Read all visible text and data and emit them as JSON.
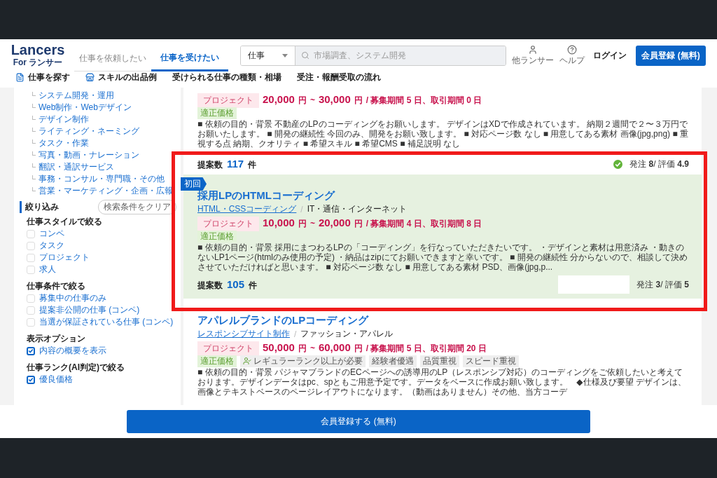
{
  "header": {
    "logo": "Lancers",
    "logo_sub": "For ランサー",
    "mode_tabs": [
      {
        "label": "仕事を依頼したい",
        "selected": false
      },
      {
        "label": "仕事を受けたい",
        "selected": true
      }
    ],
    "search": {
      "category": "仕事",
      "placeholder": "市場調査、システム開発"
    },
    "icon_links": [
      {
        "kind": "user",
        "label": "他ランサー"
      },
      {
        "kind": "help",
        "label": "ヘルプ"
      }
    ],
    "login": "ログイン",
    "register": "会員登録 (無料)"
  },
  "subnav": [
    {
      "kind": "doc",
      "label": "仕事を探す"
    },
    {
      "kind": "shop",
      "label": "スキルの出品例"
    },
    {
      "kind": "text",
      "label": "受けられる仕事の種類・相場"
    },
    {
      "kind": "text",
      "label": "受注・報酬受取の流れ"
    }
  ],
  "sidebar": {
    "categories": [
      "システム開発・運用",
      "Web制作・Webデザイン",
      "デザイン制作",
      "ライティング・ネーミング",
      "タスク・作業",
      "写真・動画・ナレーション",
      "翻訳・通訳サービス",
      "事務・コンサル・専門職・その他",
      "営業・マーケティング・企画・広報"
    ],
    "filter_title": "絞り込み",
    "clear": "検索条件をクリア",
    "groups": [
      {
        "title": "仕事スタイルで絞る",
        "options": [
          {
            "label": "コンペ",
            "checked": false
          },
          {
            "label": "タスク",
            "checked": false
          },
          {
            "label": "プロジェクト",
            "checked": false
          },
          {
            "label": "求人",
            "checked": false
          }
        ]
      },
      {
        "title": "仕事条件で絞る",
        "options": [
          {
            "label": "募集中の仕事のみ",
            "checked": false
          },
          {
            "label": "提案非公開の仕事 (コンペ)",
            "checked": false
          },
          {
            "label": "当選が保証されている仕事 (コンペ)",
            "checked": false
          }
        ]
      },
      {
        "title": "表示オプション",
        "options": [
          {
            "label": "内容の概要を表示",
            "checked": true
          }
        ]
      },
      {
        "title": "仕事ランク(AI判定)で絞る",
        "options": [
          {
            "label": "優良価格",
            "checked": true
          }
        ]
      }
    ]
  },
  "jobs": [
    {
      "highlighted": false,
      "type": "プロジェクト",
      "price": {
        "low": "20,000",
        "low_unit": "円",
        "sep": "~",
        "high": "30,000",
        "high_unit": "円",
        "terms": "/ 募集期間 5 日、取引期間 0 日"
      },
      "tags": [
        {
          "kind": "price",
          "label": "適正価格"
        }
      ],
      "description": "■ 依頼の目的・背景 不動産のLPのコーディングをお願いします。 デザインはXDで作成されています。 納期２週間で２〜３万円でお願いたします。 ■ 開発の継続性 今回のみ、開発をお願い致します。 ■ 対応ページ数 なし ■ 用意してある素材 画像(jpg,png) ■ 重視する点 納期、クオリティ ■ 希望スキル ■ 希望CMS ■ 補足説明 なし",
      "proposals_label": "提案数",
      "proposals": "117",
      "proposals_unit": "件",
      "verified": true,
      "client": "発注 **8**/ 評価 **4.9**"
    },
    {
      "highlighted": true,
      "ribbon": "初回",
      "title": "採用LPのHTMLコーディング",
      "category_link": "HTML・CSSコーディング",
      "category_sep": "/",
      "category": "IT・通信・インターネット",
      "type": "プロジェクト",
      "price": {
        "low": "10,000",
        "low_unit": "円",
        "sep": "~",
        "high": "20,000",
        "high_unit": "円",
        "terms": "/ 募集期間 4 日、取引期間 8 日"
      },
      "tags": [
        {
          "kind": "price",
          "label": "適正価格"
        }
      ],
      "description": "■ 依頼の目的・背景 採用にまつわるLPの「コーディング」を行なっていただきたいです。 ・デザインと素材は用意済み ・動きのないLP1ページ(htmlのみ使用の予定) ・納品はzipにてお願いできますと幸いです。 ■ 開発の継続性 分からないので、相談して決めさせていただければと思います。 ■ 対応ページ数 なし ■ 用意してある素材 PSD、画像(jpg,p...",
      "proposals_label": "提案数",
      "proposals": "105",
      "proposals_unit": "件",
      "verified": false,
      "client": "発注 **3**/ 評価 **5**"
    },
    {
      "highlighted": false,
      "title": "アパレルブランドのLPコーディング",
      "category_link": "レスポンシブサイト制作",
      "category_sep": "/",
      "category": "ファッション・アパレル",
      "type": "プロジェクト",
      "price": {
        "low": "50,000",
        "low_unit": "円",
        "sep": "~",
        "high": "60,000",
        "high_unit": "円",
        "terms": "/ 募集期間 5 日、取引期間 20 日"
      },
      "tags": [
        {
          "kind": "price",
          "label": "適正価格"
        },
        {
          "kind": "rank",
          "label": "レギュラーランク以上が必要"
        },
        {
          "kind": "plain",
          "label": "経験者優遇"
        },
        {
          "kind": "plain",
          "label": "品質重視"
        },
        {
          "kind": "plain",
          "label": "スピード重視"
        }
      ],
      "description": "■ 依頼の目的・背景 パジャマブランドのECページへの誘導用のLP（レスポンシブ対応）のコーディングをご依頼したいと考えております。デザインデータはpc、spともご用意予定です。データをベースに作成お願い致します。　◆仕様及び要望 デザインは、画像とテキストベースのページレイアウトになります。（動画はありません）その他、当方コーデ"
    }
  ],
  "bottom_cta": "会員登録する (無料)"
}
